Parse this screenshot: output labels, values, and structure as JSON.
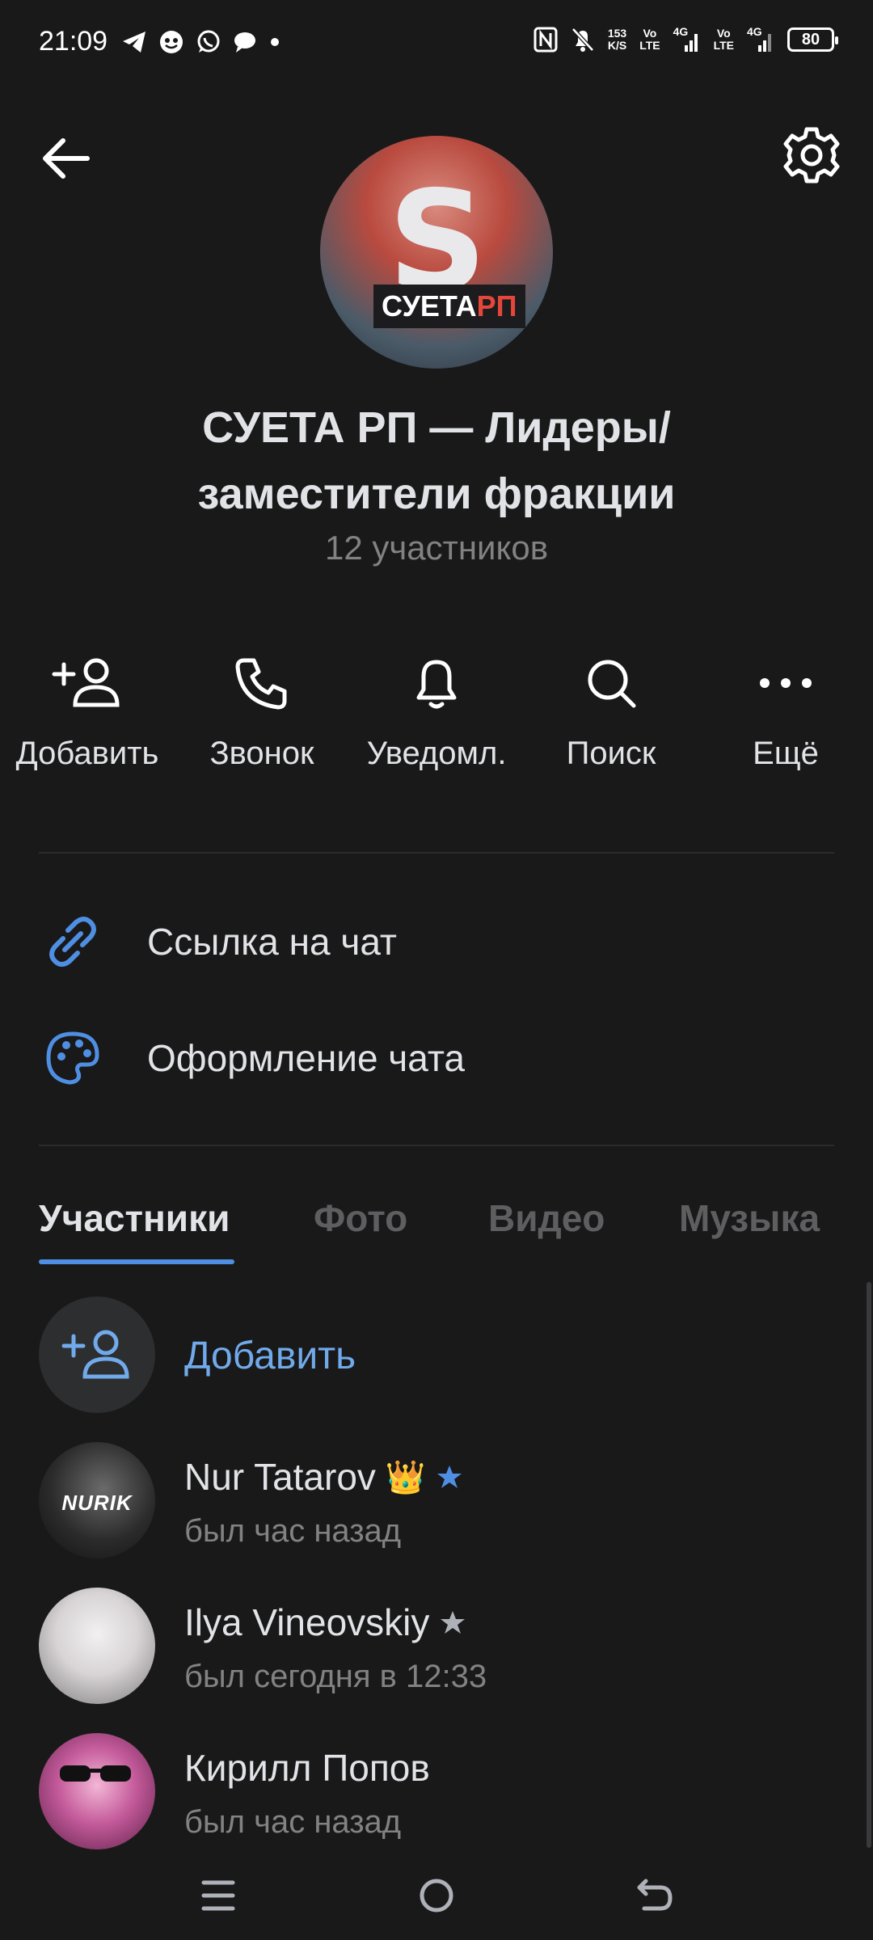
{
  "status_bar": {
    "time": "21:09",
    "net_speed_top": "153",
    "net_speed_bottom": "K/S",
    "sim1_top": "Vo",
    "sim1_bottom": "LTE",
    "sim1_net": "4G",
    "sim2_top": "Vo",
    "sim2_bottom": "LTE",
    "sim2_net": "4G",
    "battery": "80"
  },
  "header": {
    "avatar_logo_main": "СУЕТА",
    "avatar_logo_accent": "РП",
    "title": "СУЕТА РП — Лидеры/ заместители фракции",
    "subtitle": "12 участников"
  },
  "actions": [
    {
      "label": "Добавить",
      "icon": "add-user-icon"
    },
    {
      "label": "Звонок",
      "icon": "phone-icon"
    },
    {
      "label": "Уведомл.",
      "icon": "bell-icon"
    },
    {
      "label": "Поиск",
      "icon": "search-icon"
    },
    {
      "label": "Ещё",
      "icon": "more-icon"
    }
  ],
  "menu": [
    {
      "label": "Ссылка на чат",
      "icon": "link-icon"
    },
    {
      "label": "Оформление чата",
      "icon": "palette-icon"
    }
  ],
  "tabs": [
    "Участники",
    "Фото",
    "Видео",
    "Музыка"
  ],
  "members": {
    "add_label": "Добавить",
    "list": [
      {
        "name": "Nur Tatarov",
        "emoji": "👑",
        "star_color": "#4f8fe3",
        "status": "был час назад",
        "avatar_text": "NURIK"
      },
      {
        "name": "Ilya Vineovskiy",
        "emoji": "",
        "star_color": "#aeb2b8",
        "status": "был сегодня в 12:33",
        "avatar_text": ""
      },
      {
        "name": "Кирилл Попов",
        "emoji": "",
        "star_color": "",
        "status": "был час назад",
        "avatar_text": ""
      }
    ]
  },
  "colors": {
    "background": "#19191a",
    "accent": "#71aaeb",
    "tab_underline": "#4f8fe3"
  }
}
